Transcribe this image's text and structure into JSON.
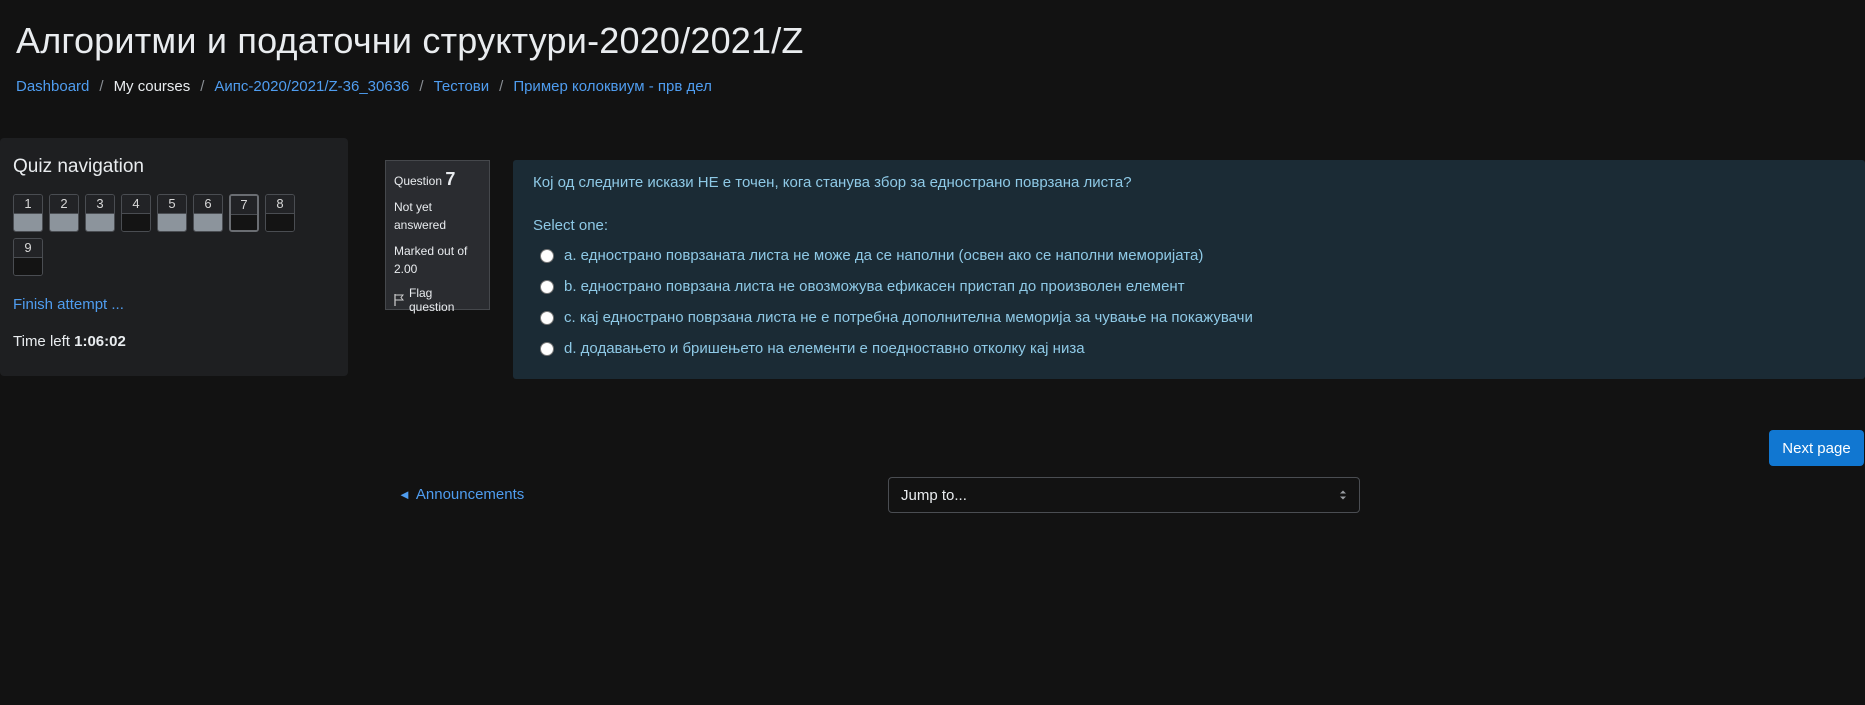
{
  "page": {
    "title": "Алгоритми и податочни структури-2020/2021/Z"
  },
  "breadcrumb": {
    "items": [
      {
        "label": "Dashboard",
        "link": true
      },
      {
        "label": "My courses",
        "link": false
      },
      {
        "label": "Аипс-2020/2021/Z-36_30636",
        "link": true
      },
      {
        "label": "Тестови",
        "link": true
      },
      {
        "label": "Пример колоквиум - прв дел",
        "link": true
      }
    ],
    "separator": "/"
  },
  "quiz_nav": {
    "title": "Quiz navigation",
    "buttons": [
      {
        "label": "1",
        "state": "answered"
      },
      {
        "label": "2",
        "state": "answered"
      },
      {
        "label": "3",
        "state": "answered"
      },
      {
        "label": "4",
        "state": "notanswered"
      },
      {
        "label": "5",
        "state": "answered"
      },
      {
        "label": "6",
        "state": "answered"
      },
      {
        "label": "7",
        "state": "current"
      },
      {
        "label": "8",
        "state": "notanswered"
      },
      {
        "label": "9",
        "state": "notanswered"
      }
    ],
    "finish_label": "Finish attempt ...",
    "time_left_label": "Time left",
    "time_left_value": "1:06:02"
  },
  "question_info": {
    "question_label": "Question",
    "question_number": "7",
    "state": "Not yet answered",
    "grade_label": "Marked out of 2.00",
    "flag_label": "Flag question",
    "flag_icon": "flag-icon"
  },
  "question": {
    "text": "Кој од следните искази НЕ е точен, кога станува збор за еднострано поврзана листа?",
    "prompt": "Select one:",
    "answers": [
      "a. еднострано поврзаната листа не може да се наполни (освен ако се наполни меморијата)",
      "b. еднострано поврзана листа не овозможува ефикасен пристап до произволен елемент",
      "c. кај еднострано поврзана листа не е потребна дополнителна меморија за чување на покажувачи",
      "d. додавањето и бришењето на елементи е поедноставно отколку кај низа"
    ]
  },
  "actions": {
    "next_label": "Next page"
  },
  "footer_nav": {
    "prev_arrow": "◄",
    "prev_label": "Announcements",
    "jump_placeholder": "Jump to..."
  },
  "colors": {
    "background": "#121212",
    "link": "#4f9df0",
    "question_bg": "#1b2b35",
    "question_text": "#8ec9e6",
    "primary_button": "#1177d1",
    "answered_fill": "#8c949c"
  }
}
